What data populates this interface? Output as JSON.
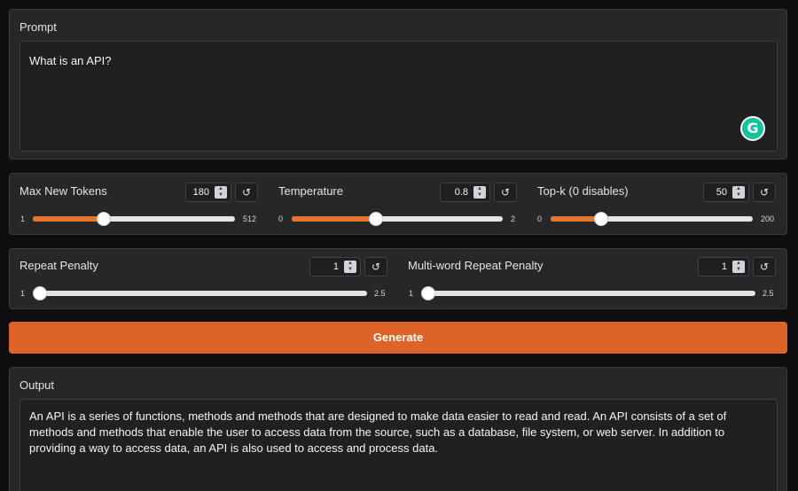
{
  "prompt": {
    "label": "Prompt",
    "value": "What is an API?"
  },
  "sliders": [
    {
      "label": "Max New Tokens",
      "value": "180",
      "min": "1",
      "max": "512",
      "fraction": 0.35
    },
    {
      "label": "Temperature",
      "value": "0.8",
      "min": "0",
      "max": "2",
      "fraction": 0.4
    },
    {
      "label": "Top-k (0 disables)",
      "value": "50",
      "min": "0",
      "max": "200",
      "fraction": 0.25
    },
    {
      "label": "Repeat Penalty",
      "value": "1",
      "min": "1",
      "max": "2.5",
      "fraction": 0.0
    },
    {
      "label": "Multi-word Repeat Penalty",
      "value": "1",
      "min": "1",
      "max": "2.5",
      "fraction": 0.0
    }
  ],
  "generate_label": "Generate",
  "output": {
    "label": "Output",
    "value": "An API is a series of functions, methods and methods that are designed to make data easier to read and read. An API consists of a set of methods and methods that enable the user to access data from the source, such as a database, file system, or web server. In addition to providing a way to access data, an API is also used to access and process data."
  },
  "icons": {
    "reset": "reset-icon",
    "spin": "spinner-arrows-icon",
    "grammarly": "grammarly-icon"
  },
  "colors": {
    "accent": "#de6328",
    "slider_fill": "#e8732c",
    "panel": "#27272a",
    "background": "#0f0f11"
  }
}
